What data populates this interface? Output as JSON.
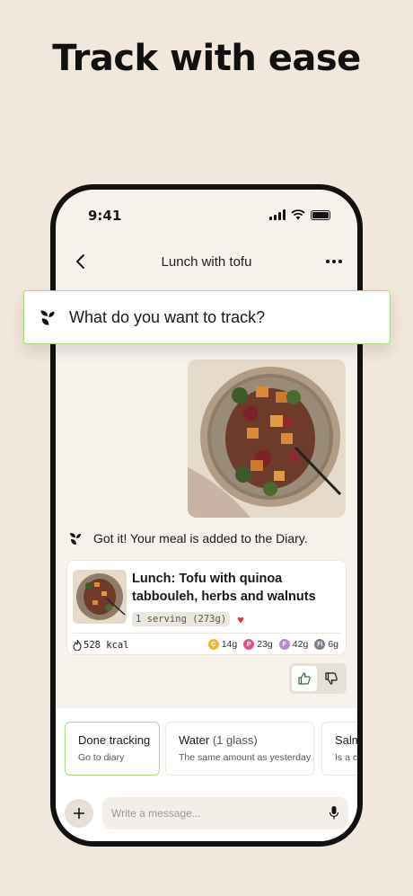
{
  "headline": "Track with ease",
  "status_bar": {
    "time": "9:41"
  },
  "nav": {
    "title": "Lunch with tofu"
  },
  "track_prompt": {
    "text": "What do you want to track?"
  },
  "chat": {
    "reply": "Got it! Your meal is added to the Diary."
  },
  "meal": {
    "name": "Lunch: Tofu with quinoa tabbouleh, herbs and walnuts",
    "serving": "1 serving (273g)",
    "kcal": "528 kcal",
    "macros": [
      {
        "letter": "C",
        "value": "14g",
        "color": "#f0b63c"
      },
      {
        "letter": "P",
        "value": "23g",
        "color": "#e0578a"
      },
      {
        "letter": "F",
        "value": "42g",
        "color": "#b78ad9"
      },
      {
        "letter": "Fi",
        "value": "6g",
        "color": "#7b7f86"
      }
    ]
  },
  "suggestions": [
    {
      "title": "Done tracking",
      "title_sub": "",
      "subtitle": "Go to diary"
    },
    {
      "title": "Water",
      "title_sub": "(1 glass)",
      "subtitle": "The same amount as yesterday"
    },
    {
      "title": "Salm",
      "title_sub": "",
      "subtitle": "Is a co"
    }
  ],
  "composer": {
    "placeholder": "Write a message..."
  },
  "colors": {
    "background": "#f2e7dc",
    "accent_green": "#a9e07f",
    "heart": "#e0324b"
  }
}
